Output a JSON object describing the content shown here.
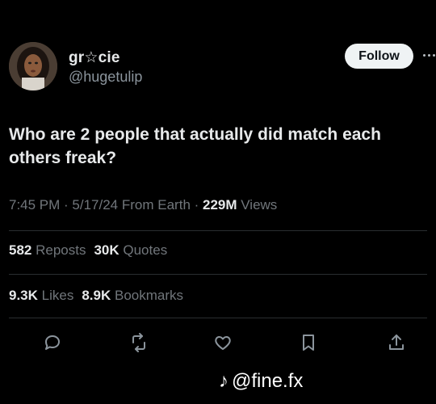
{
  "user": {
    "display_name": "gr☆cie",
    "handle": "@hugetulip"
  },
  "header": {
    "follow_label": "Follow"
  },
  "tweet": {
    "text": "Who are 2 people that actually did match each others freak?"
  },
  "meta": {
    "time": "7:45 PM",
    "sep1": " · ",
    "date": "5/17/24",
    "source": " From Earth",
    "sep2": " · ",
    "views_count": "229M",
    "views_label": " Views"
  },
  "stats_row_1": [
    {
      "count": "582",
      "label": " Reposts"
    },
    {
      "count": "30K",
      "label": " Quotes"
    }
  ],
  "stats_row_2": [
    {
      "count": "9.3K",
      "label": " Likes"
    },
    {
      "count": "8.9K",
      "label": " Bookmarks"
    }
  ],
  "actions": [
    "reply-icon",
    "repost-icon",
    "like-icon",
    "bookmark-icon",
    "share-icon"
  ],
  "watermark": {
    "text": "@fine.fx",
    "icon": "tiktok-icon"
  },
  "colors": {
    "background": "#000000",
    "primary_text": "#e7e9ea",
    "secondary_text": "#71767b",
    "follow_button_bg": "#eff3f4"
  }
}
